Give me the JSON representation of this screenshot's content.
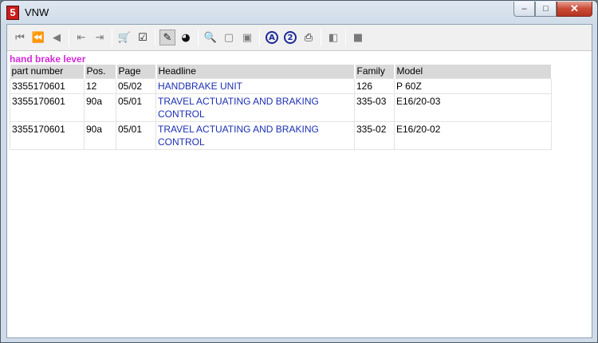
{
  "window": {
    "title": "VNW",
    "app_icon_glyph": "5",
    "controls": {
      "minimize": "–",
      "maximize": "□",
      "close": "✕"
    }
  },
  "toolbar": {
    "buttons": [
      {
        "name": "first-record-icon",
        "glyph": "⏮",
        "active": false
      },
      {
        "name": "previous-page-icon",
        "glyph": "⏪",
        "active": false
      },
      {
        "name": "previous-record-icon",
        "glyph": "◀",
        "active": false
      },
      {
        "name": "page-back-icon",
        "glyph": "⇤",
        "active": false
      },
      {
        "name": "page-forward-icon",
        "glyph": "⇥",
        "active": false
      },
      {
        "name": "cart-icon",
        "glyph": "🛒",
        "active": true
      },
      {
        "name": "checklist-icon",
        "glyph": "☑",
        "active": true
      },
      {
        "name": "no-pencil-icon",
        "glyph": "✎",
        "active": true,
        "pressed": true
      },
      {
        "name": "globe-icon",
        "glyph": "◕",
        "active": true
      },
      {
        "name": "zoom-icon",
        "glyph": "🔍",
        "active": false
      },
      {
        "name": "page-icon",
        "glyph": "▢",
        "active": false
      },
      {
        "name": "page-alt-icon",
        "glyph": "▣",
        "active": false
      },
      {
        "name": "text-a-icon",
        "glyph": "A",
        "circle": true
      },
      {
        "name": "text-2-icon",
        "glyph": "2",
        "circle": true
      },
      {
        "name": "print-icon",
        "glyph": "⎙",
        "active": true
      },
      {
        "name": "eraser-icon",
        "glyph": "◧",
        "active": false
      },
      {
        "name": "stop-icon",
        "glyph": "■",
        "active": false
      }
    ]
  },
  "search_title": "hand brake lever",
  "table": {
    "headers": [
      "part number",
      "Pos.",
      "Page",
      "Headline",
      "Family",
      "Model"
    ],
    "rows": [
      [
        "3355170601",
        "12",
        "05/02",
        "HANDBRAKE UNIT",
        "126",
        "P 60Z"
      ],
      [
        "3355170601",
        "90a",
        "05/01",
        "TRAVEL ACTUATING AND BRAKING CONTROL",
        "335-03",
        "E16/20-03"
      ],
      [
        "3355170601",
        "90a",
        "05/01",
        "TRAVEL ACTUATING AND BRAKING CONTROL",
        "335-02",
        "E16/20-02"
      ]
    ]
  }
}
